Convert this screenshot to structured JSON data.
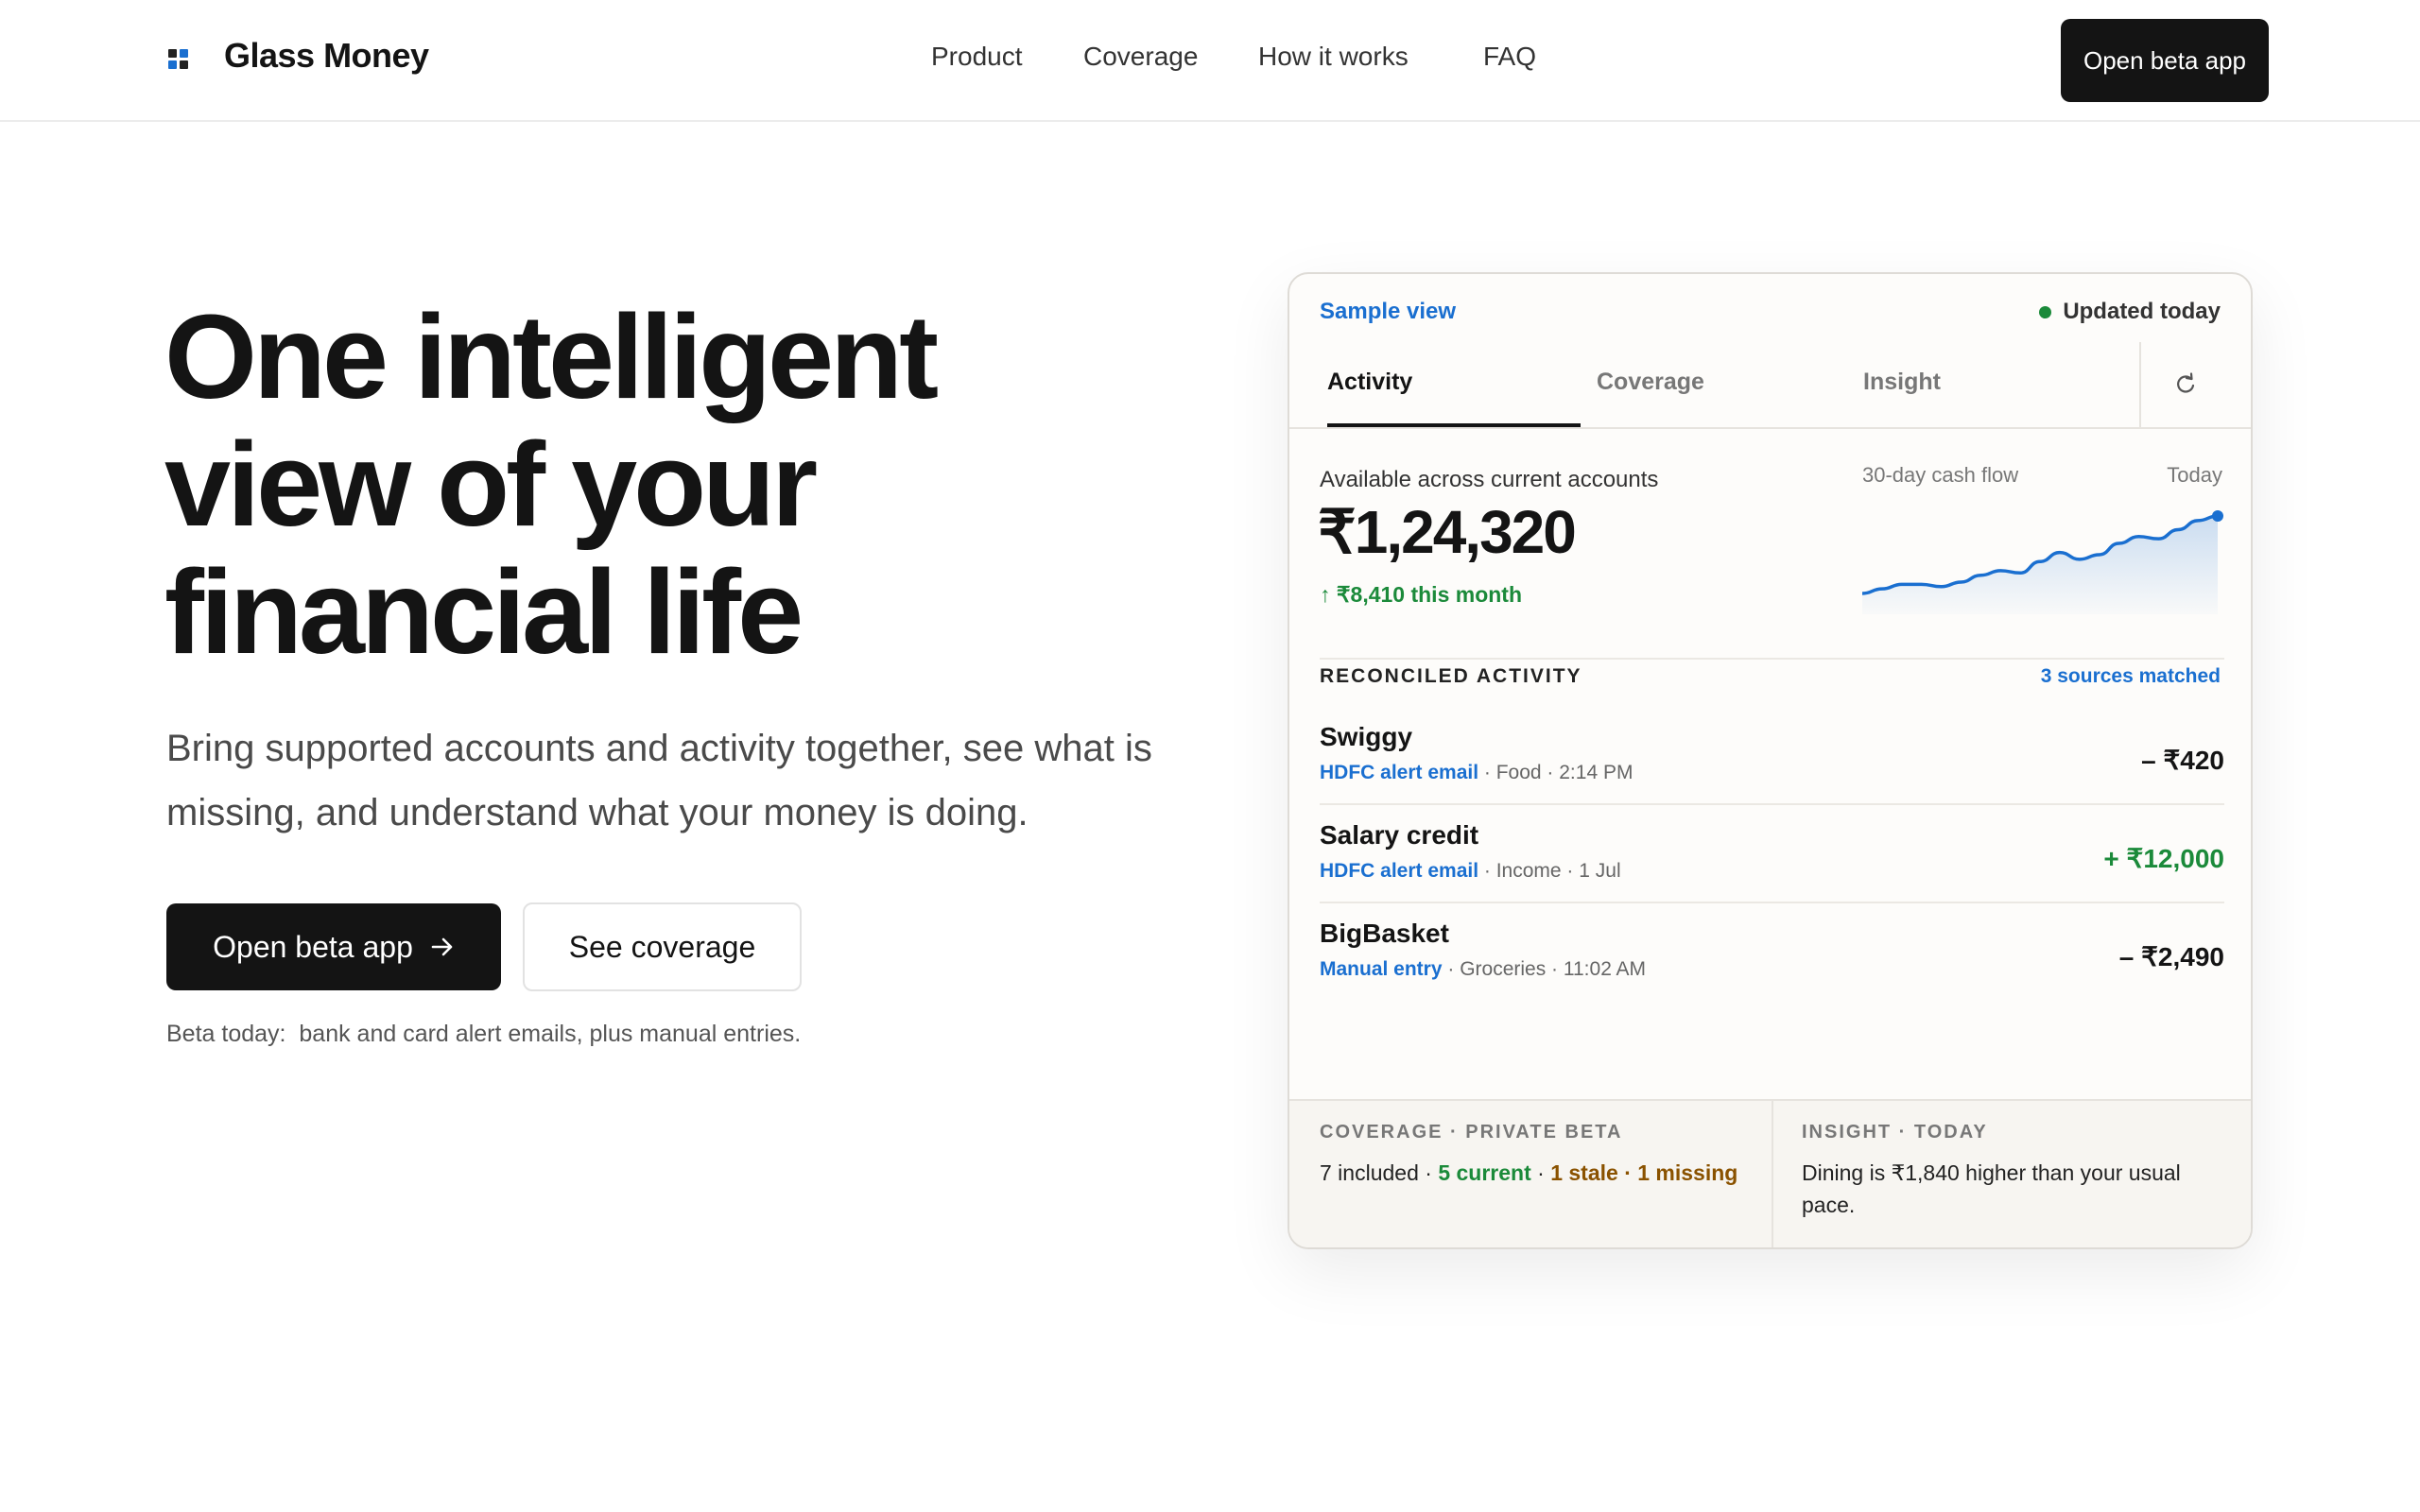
{
  "brand": {
    "name": "Glass Money",
    "logo_icon": "grid-logo-icon"
  },
  "nav": {
    "items": [
      "Product",
      "Coverage",
      "How it works",
      "FAQ"
    ],
    "cta": "Open beta app"
  },
  "hero": {
    "title_lines": [
      "One intelligent",
      "view of your",
      "financial life"
    ],
    "subtitle": "Bring supported accounts and activity together, see what is missing, and understand what your money is doing.",
    "primary_cta": "Open beta app",
    "primary_cta_icon": "arrow-right-icon",
    "secondary_cta": "See coverage",
    "note_label": "Beta today:",
    "note_text": "bank and card alert emails, plus manual entries."
  },
  "card": {
    "label": "Sample view",
    "status": "Updated today",
    "tabs": [
      "Activity",
      "Coverage",
      "Insight"
    ],
    "active_tab": "Activity",
    "refresh_icon": "refresh-icon",
    "balance": {
      "label": "Available across current accounts",
      "amount": "₹1,24,320",
      "change": "₹8,410 this month",
      "change_icon": "arrow-up-icon"
    },
    "cashflow": {
      "label": "30-day cash flow",
      "end_label": "Today",
      "color": "#1a6fd0",
      "values": [
        2,
        3,
        4,
        4,
        3.5,
        4.5,
        6,
        7,
        6.5,
        9,
        11,
        9.5,
        10.5,
        13,
        14.5,
        14,
        16,
        18,
        19
      ]
    },
    "activity": {
      "title": "RECONCILED ACTIVITY",
      "matched": "3 sources matched",
      "items": [
        {
          "name": "Swiggy",
          "source": "HDFC alert email",
          "meta": " · Food · 2:14 PM",
          "amount": "– ₹420",
          "positive": false
        },
        {
          "name": "Salary credit",
          "source": "HDFC alert email",
          "meta": " · Income · 1 Jul",
          "amount": "+ ₹12,000",
          "positive": true
        },
        {
          "name": "BigBasket",
          "source": "Manual entry",
          "meta": " · Groceries · 11:02 AM",
          "amount": "– ₹2,490",
          "positive": false
        }
      ]
    },
    "footer": {
      "coverage_title": "COVERAGE · PRIVATE BETA",
      "coverage_included": "7 included · ",
      "coverage_current": "5 current",
      "coverage_sep": " · ",
      "coverage_stale": "1 stale · 1 missing",
      "insight_title": "INSIGHT · TODAY",
      "insight_text": "Dining is ₹1,840 higher than your usual pace."
    }
  },
  "colors": {
    "accent": "#1a6fd0",
    "positive": "#1b8a3a",
    "warning": "#8a5200",
    "ink": "#141414"
  }
}
